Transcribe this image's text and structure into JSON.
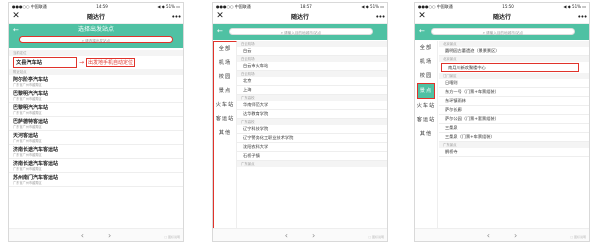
{
  "phone1": {
    "status_left": "●●●○○ 中国联通 ",
    "status_time": "14:59",
    "status_right": "◀ ◆ 51% ▭",
    "nav_close": "✕",
    "nav_title": "随达行",
    "nav_more": "•••",
    "hero_back": "←",
    "hero_title": "选择出发站点",
    "search_placeholder": "请选择出发站点",
    "section_location": "当前定位",
    "highlight_station": "文县汽车站",
    "annotation": "出发地手机自动定位",
    "section_nearby": "附近站点",
    "stations": [
      {
        "name": "阿尔阶亭汽车站",
        "addr": "广东省广州市越秀区"
      },
      {
        "name": "巴黎明汽汽车站",
        "addr": "广东省广州市越秀区"
      },
      {
        "name": "巴黎明汽汽车站",
        "addr": "广东省广州市越秀区"
      },
      {
        "name": "巴萨德特客运站",
        "addr": "广东省广州市越秀区"
      },
      {
        "name": "天河客运站",
        "addr": "广州省广州市越秀区"
      },
      {
        "name": "济南长途汽车客运站",
        "addr": "广东省广州市越秀区"
      },
      {
        "name": "济南长途汽车客运站",
        "addr": "广东省广州市越秀区"
      },
      {
        "name": "苏州南门汽车客运站",
        "addr": "广东省广州市越秀区"
      }
    ],
    "bottom_back": "‹",
    "bottom_fwd": "›",
    "watermark": "□ 图标说明"
  },
  "phone2": {
    "status_left": "●●●○○ 中国联通 ",
    "status_time": "18:57",
    "status_right": "◀ ◆ 51% ▭",
    "nav_close": "✕",
    "nav_title": "随达行",
    "nav_more": "•••",
    "hero_back": "←",
    "search_placeholder": "请输入目的地城市/站点",
    "side": [
      "全部",
      "机场",
      "校园",
      "景点",
      "火车站",
      "客运站",
      "其他"
    ],
    "groups": [
      {
        "section": "白云机场",
        "items": [
          "白云"
        ]
      },
      {
        "section": "白云机场",
        "items": [
          "白云市火车站"
        ]
      },
      {
        "section": "白云机场",
        "items": [
          "北京",
          "上海"
        ]
      },
      {
        "section": "广东高校",
        "items": [
          "华南师范大学",
          "达华教育学院"
        ]
      },
      {
        "section": "广东高校",
        "items": [
          "辽宁科技学院",
          "辽宁警务化工职业技术学院",
          "沈阳农科大学",
          "石桥子镇"
        ]
      },
      {
        "section": "广东景点",
        "items": []
      }
    ],
    "bottom_back": "‹",
    "bottom_fwd": "›",
    "watermark": "□ 图标说明"
  },
  "phone3": {
    "status_left": "●●●○○ 中国联通 ",
    "status_time": "15:50",
    "status_right": "◀ ◆ 51% ▭",
    "nav_close": "✕",
    "nav_title": "随达行",
    "nav_more": "•••",
    "hero_back": "←",
    "search_placeholder": "请输入目的地城市/站点",
    "side": [
      "全部",
      "机场",
      "校园",
      "景点",
      "火车站",
      "客运站",
      "其他"
    ],
    "side_active": "景点",
    "sections": [
      {
        "section": "北京景点",
        "items": [
          "圆明园古墓遗迹（景景景区）"
        ]
      },
      {
        "section": "北京景点",
        "items": [
          "南月川新欢聚楼中心"
        ]
      },
      {
        "section": "江门景区",
        "items": [
          "日喀则",
          "东方一号（门票+车票组装）",
          "东环镇雨林",
          "萨尔长廊",
          "萨尔公园（门票+套票组装）",
          "三桑泉",
          "三桑泉（门票+车票组装）"
        ]
      },
      {
        "section": "广东景点",
        "items": [
          "鹊桥寺"
        ]
      }
    ],
    "highlight_index": 1,
    "bottom_back": "‹",
    "bottom_fwd": "›",
    "watermark": "□ 图标说明"
  }
}
